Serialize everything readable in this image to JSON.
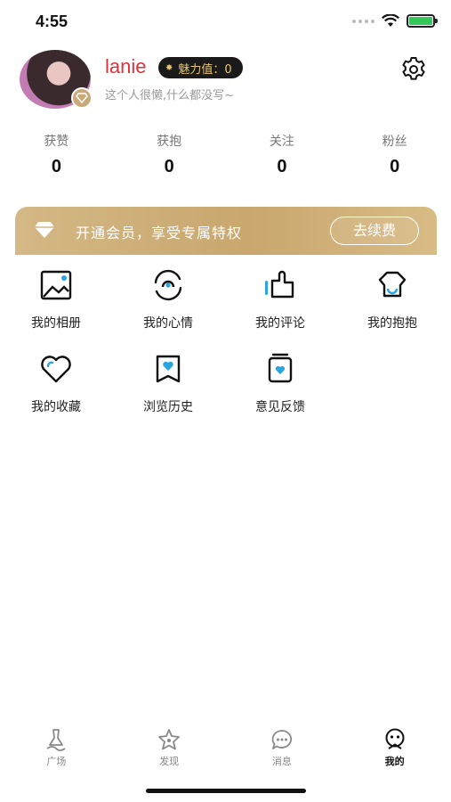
{
  "status_bar": {
    "time": "4:55"
  },
  "profile": {
    "username": "lanie",
    "charm_label": "魅力值：0",
    "signature": "这个人很懒,什么都没写~"
  },
  "stats": [
    {
      "label": "获赞",
      "value": "0"
    },
    {
      "label": "获抱",
      "value": "0"
    },
    {
      "label": "关注",
      "value": "0"
    },
    {
      "label": "粉丝",
      "value": "0"
    }
  ],
  "vip_banner": {
    "text": "开通会员，享受专属特权",
    "button": "去续费"
  },
  "menu": [
    {
      "label": "我的相册",
      "icon": "album-icon"
    },
    {
      "label": "我的心情",
      "icon": "mood-icon"
    },
    {
      "label": "我的评论",
      "icon": "comment-icon"
    },
    {
      "label": "我的抱抱",
      "icon": "hug-icon"
    },
    {
      "label": "我的收藏",
      "icon": "favorite-icon"
    },
    {
      "label": "浏览历史",
      "icon": "history-icon"
    },
    {
      "label": "意见反馈",
      "icon": "feedback-icon"
    }
  ],
  "tabs": [
    {
      "label": "广场",
      "icon": "plaza-icon"
    },
    {
      "label": "发现",
      "icon": "discover-icon"
    },
    {
      "label": "消息",
      "icon": "message-icon"
    },
    {
      "label": "我的",
      "icon": "profile-icon"
    }
  ],
  "colors": {
    "accent_gold": "#c9a76e",
    "username_red": "#e0303a",
    "battery_green": "#35c759"
  }
}
